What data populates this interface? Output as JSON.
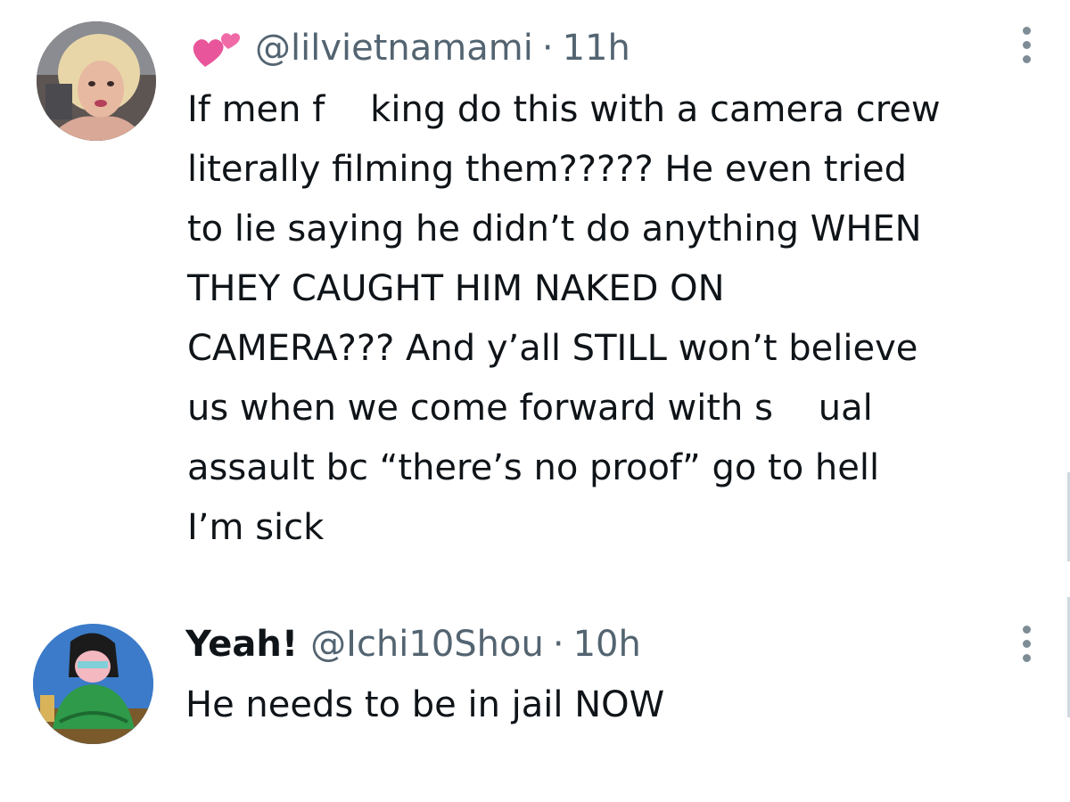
{
  "tweets": [
    {
      "emoji": "💞",
      "display_name": "",
      "handle": "@lilvietnamami",
      "separator": "·",
      "time": "11h",
      "text": "If men f    king do this with a camera crew\nliterally filming them????? He even tried\nto lie saying he didn’t do anything WHEN\nTHEY CAUGHT HIM NAKED ON\nCAMERA??? And y’all STILL won’t believe\nus when we come forward with s    ual\nassault bc “there’s no proof” go to hell\nI’m sick"
    },
    {
      "display_name": "Yeah!",
      "handle": "@Ichi10Shou",
      "separator": "·",
      "time": "10h",
      "text": "He needs to be in jail NOW"
    }
  ],
  "colors": {
    "text": "#0f1419",
    "secondary": "#536471",
    "heart_pink": "#e8559a"
  },
  "icons": {
    "more_menu": "more-vertical-icon",
    "emoji": "two-hearts-icon"
  }
}
